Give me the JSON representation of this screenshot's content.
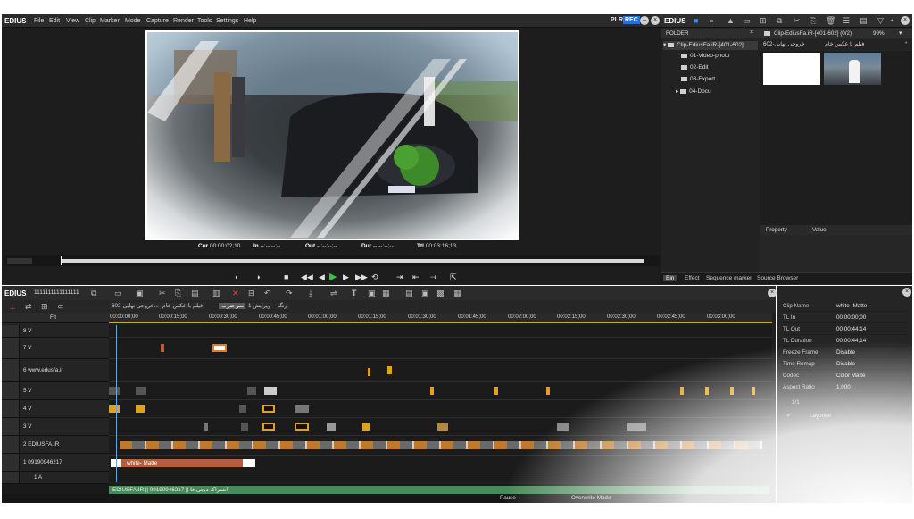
{
  "preview": {
    "logo": "EDIUS",
    "menu": [
      "File",
      "Edit",
      "View",
      "Clip",
      "Marker",
      "Mode",
      "Capture",
      "Render",
      "Tools",
      "Settings",
      "Help"
    ],
    "plr": "PLR",
    "rec": "REC",
    "timecodes": {
      "cur_label": "Cur",
      "cur": "00:00:02;10",
      "in_label": "In",
      "in": "--:--:--;--",
      "out_label": "Out",
      "out": "--:--:--;--",
      "dur_label": "Dur",
      "dur": "--:--:--;--",
      "ttl_label": "Ttl",
      "ttl": "00:03:16;13"
    }
  },
  "bin": {
    "logo": "EDIUS",
    "folder_label": "FOLDER",
    "clip_header": "Clip-EdiusFa.iR-[401-602] (0/2)",
    "zoom": "99%",
    "tree": [
      {
        "label": "Clip-EdiusFa.iR-[401-602]",
        "selected": true
      },
      {
        "label": "01-Video-photo"
      },
      {
        "label": "02-Edit"
      },
      {
        "label": "03-Export"
      },
      {
        "label": "04-Docu"
      }
    ],
    "clip_tabs": [
      "خروجی نهایی-602",
      "فیلم با عکس خام"
    ],
    "property_label": "Property",
    "value_label": "Value",
    "tabs": [
      "Bin",
      "Effect",
      "Sequence marker",
      "Source Browser"
    ]
  },
  "timeline": {
    "logo": "EDIUS",
    "project": "1111111111111111",
    "seq_tabs": [
      "602-خروجی نهایی...",
      "فیلم با عکس خام",
      "سر ضرب",
      "ویرایش 1",
      "رنگ"
    ],
    "active_tab": 2,
    "fit": "Fit",
    "ruler": [
      "00:00:00;00",
      "00:00:15;00",
      "00:00:30;00",
      "00:00:45;00",
      "00:01:00;00",
      "00:01:15;00",
      "00:01:30;00",
      "00:01:45;00",
      "00:02:00;00",
      "00:02:15;00",
      "00:02:30;00",
      "00:02:45;00",
      "00:03:00;00"
    ],
    "tracks": [
      "8 V",
      "7 V",
      "6 www.edusfa.ir",
      "5 V",
      "4 V",
      "3 V",
      "2 EDIUSFA.IR",
      "1 09190946217",
      "1 A"
    ],
    "matte_label": "white- Matte",
    "audio_label": "EDIUSFA.IR || 09190946217 || اشتراک دیجی فا",
    "status_pause": "Pause",
    "status_mode": "Overwrite Mode"
  },
  "info": {
    "rows": [
      {
        "k": "Clip Name",
        "v": "white- Matte"
      },
      {
        "k": "TL In",
        "v": "00:00:00;00"
      },
      {
        "k": "TL Out",
        "v": "00:00:44;14"
      },
      {
        "k": "TL Duration",
        "v": "00:00:44;14"
      },
      {
        "k": "Freeze Frame",
        "v": "Disable"
      },
      {
        "k": "Time Remap",
        "v": "Disable"
      },
      {
        "k": "Codec",
        "v": "Color Matte"
      },
      {
        "k": "Aspect Ratio",
        "v": "1.000"
      }
    ],
    "count": "1/1",
    "layouter": "Layouter"
  }
}
